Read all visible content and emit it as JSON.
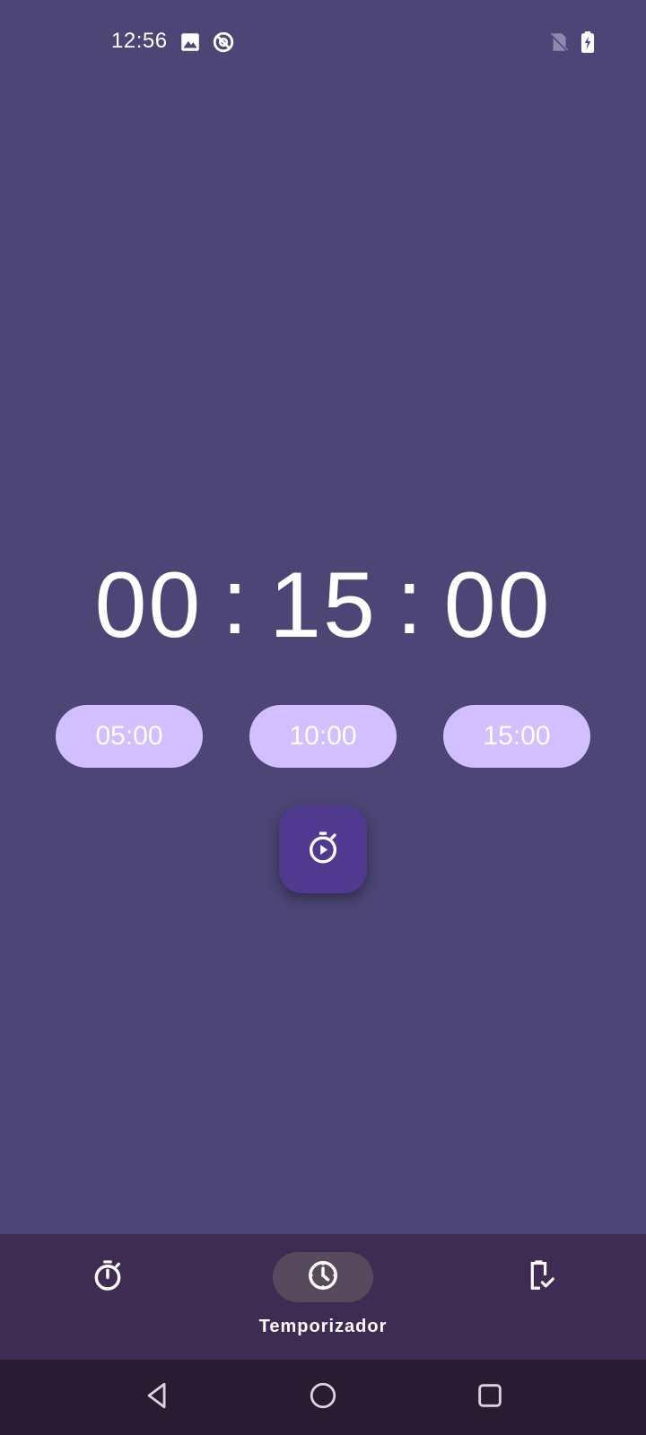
{
  "status_bar": {
    "time": "12:56",
    "icons": [
      "image-icon",
      "do-not-disturb-icon",
      "no-sim-icon",
      "battery-charging-icon"
    ]
  },
  "timer": {
    "hours": "00",
    "minutes": "15",
    "seconds": "00",
    "separator": ":"
  },
  "presets": [
    {
      "label": "05:00"
    },
    {
      "label": "10:00"
    },
    {
      "label": "15:00"
    }
  ],
  "fab": {
    "icon": "timer-play-icon"
  },
  "bottom_nav": {
    "items": [
      {
        "icon": "stopwatch-icon",
        "label": "",
        "active": false
      },
      {
        "icon": "clock-timer-icon",
        "label": "Temporizador",
        "active": true
      },
      {
        "icon": "battery-check-icon",
        "label": "",
        "active": false
      }
    ]
  },
  "system_nav": {
    "buttons": [
      "back-icon",
      "home-icon",
      "recents-icon"
    ]
  },
  "colors": {
    "background": "#4c4575",
    "preset_chip": "#d2bfff",
    "fab": "#4f3a90",
    "bottom_nav": "#3f2c52",
    "active_pill": "#564a5c",
    "system_nav": "#281c32"
  }
}
